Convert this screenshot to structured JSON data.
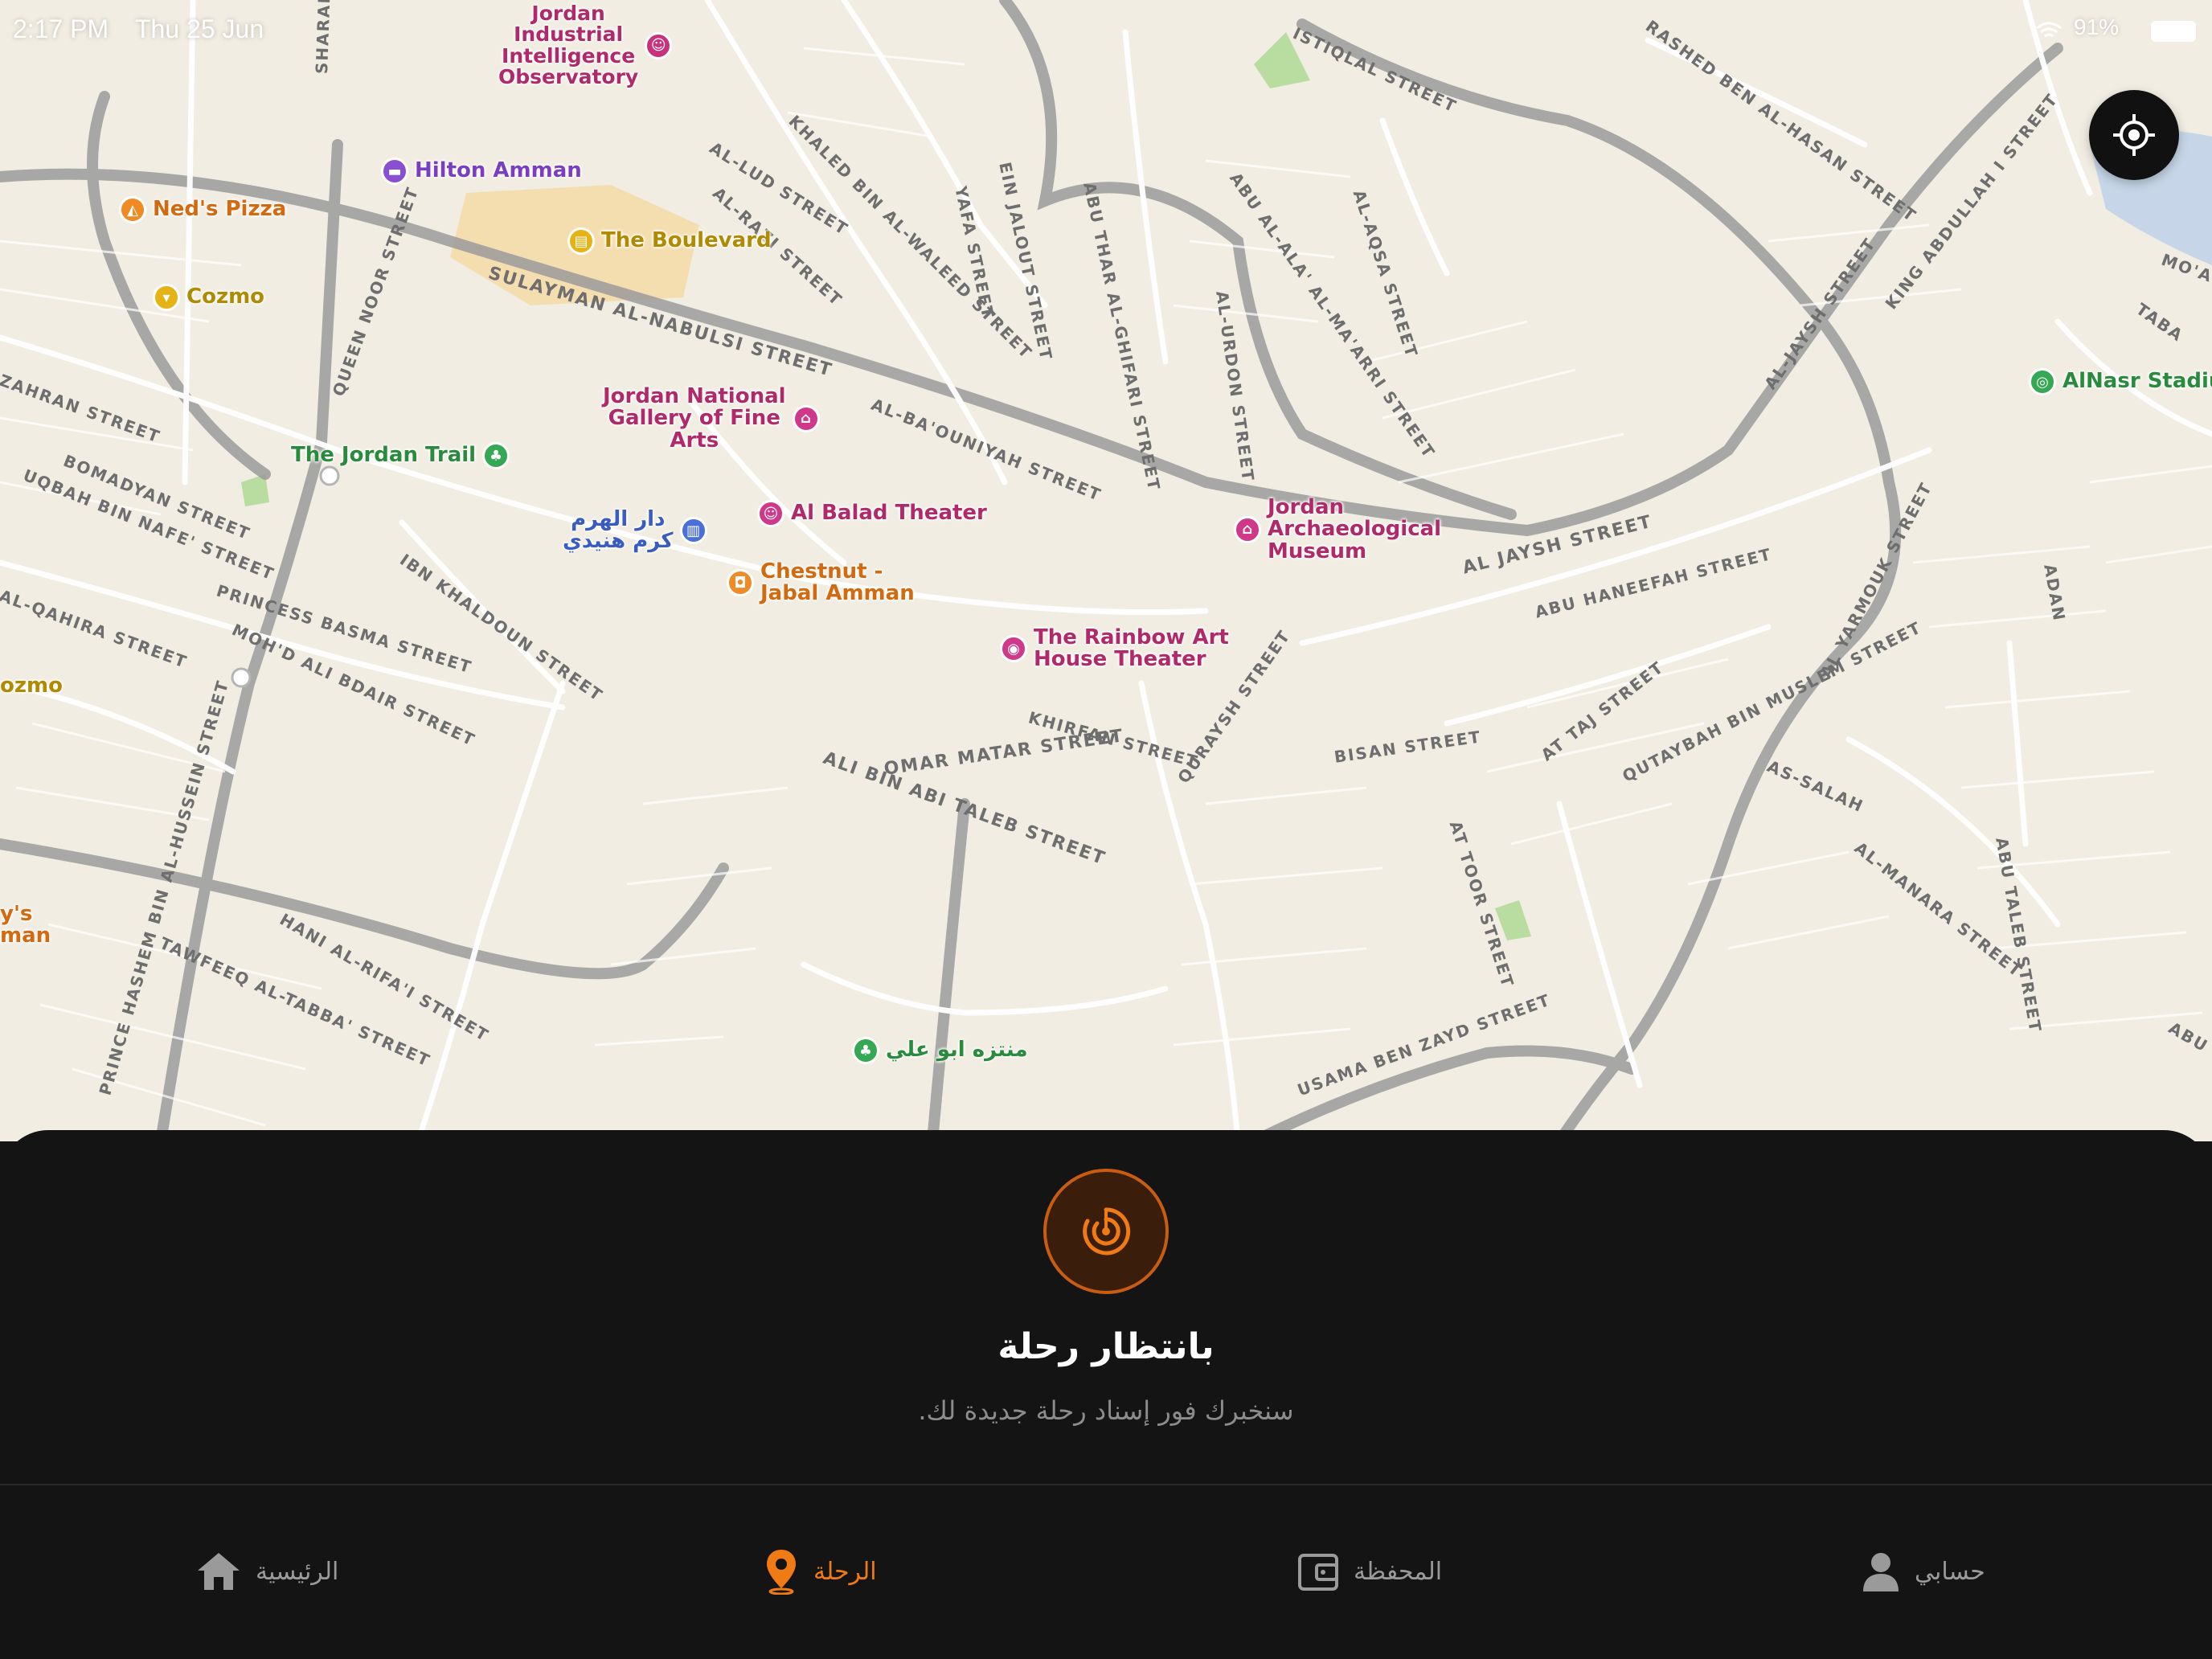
{
  "status_bar": {
    "time": "2:17 PM",
    "date": "Thu 25 Jun",
    "battery": "91%"
  },
  "map": {
    "streets": [
      "ISTIQLAL STREET",
      "RASHED BEN AL-HASAN STREET",
      "KHALED BIN AL-WALEED STREET",
      "AL-LUD STREET",
      "AL-RAZI STREET",
      "SULAYMAN AL-NABULSI STREET",
      "AL-BA'OUNIYAH STREET",
      "QUEEN NOOR STREET",
      "ZAHRAN STREET",
      "BOMADYAN STREET",
      "UQBAH BIN NAFE' STREET",
      "PRINCESS BASMA STREET",
      "IBN KHALDOUN STREET",
      "MOH'D ALI BDAIR STREET",
      "AL-QAHIRA STREET",
      "PRINCE HASHEM BIN AL-HUSSEIN STREET",
      "TAWFEEQ AL-TABBA' STREET",
      "HANI AL-RIFA'I STREET",
      "OMAR MATAR STREET",
      "ALI BIN ABI TALEB STREET",
      "KHIRFAN STREET",
      "QURAYSH STREET",
      "AL JAYSH STREET",
      "AL-JAYSH STREET",
      "KING ABDULLAH I STREET",
      "ABU HANEEFAH STREET",
      "BISAN STREET",
      "AT TAJ STREET",
      "QUTAYBAH BIN MUSLEM STREET",
      "AL YARMOUK STREET",
      "AS-SALAH",
      "AL-MANARA STREET",
      "ABU TALEB STREET",
      "AT TOOR STREET",
      "USAMA BEN ZAYD STREET",
      "AL-URDON STREET",
      "ABU AL-ALA' AL-MA'ARRI STREET",
      "AL-AQSA STREET",
      "ABU THAR AL-GHIFARI STREET",
      "EIN JALOUT STREET",
      "YAFA STREET",
      "SHARAF STREET",
      "ADAN",
      "TABA",
      "MO'AWE",
      "ABU"
    ],
    "pois": [
      {
        "name": "Jordan\nIndustrial\nIntelligence\nObservatory",
        "color": "#c8327a",
        "icon": "theater-icon"
      },
      {
        "name": "Hilton Amman",
        "color": "#8a4fd1",
        "icon": "hotel-icon"
      },
      {
        "name": "Ned's Pizza",
        "color": "#f08a24",
        "icon": "pizza-icon"
      },
      {
        "name": "The Boulevard",
        "color": "#e5b315",
        "icon": "shopping-icon"
      },
      {
        "name": "Cozmo",
        "color": "#e5b315",
        "icon": "cart-icon"
      },
      {
        "name": "Jordan National\nGallery of Fine\nArts",
        "color": "#d0388a",
        "icon": "museum-icon"
      },
      {
        "name": "The Jordan Trail",
        "color": "#34a853",
        "icon": "tree-icon"
      },
      {
        "name": "دار الهرم\nكرم هنيدي",
        "color": "#4a6fd6",
        "icon": "building-icon"
      },
      {
        "name": "Al Balad Theater",
        "color": "#d0388a",
        "icon": "theater-icon"
      },
      {
        "name": "Chestnut -\nJabal Amman",
        "color": "#f08a24",
        "icon": "cafe-icon"
      },
      {
        "name": "Jordan\nArchaeological\nMuseum",
        "color": "#d0388a",
        "icon": "museum-icon"
      },
      {
        "name": "The Rainbow Art\nHouse Theater",
        "color": "#d0388a",
        "icon": "cinema-icon"
      },
      {
        "name": "AlNasr Stadium",
        "color": "#34a853",
        "icon": "stadium-icon"
      },
      {
        "name": "منتزه ابو علي",
        "color": "#34a853",
        "icon": "tree-icon"
      },
      {
        "name": "ozmo",
        "color": "#e5b315",
        "icon": ""
      },
      {
        "name": "y's\nman",
        "color": "#f08a24",
        "icon": ""
      }
    ]
  },
  "locate_button": {
    "icon": "locate-icon"
  },
  "sheet": {
    "icon": "radar-icon",
    "title": "بانتظار رحلة",
    "subtitle": "سنخبرك فور إسناد رحلة جديدة لك."
  },
  "tabs": [
    {
      "id": "home",
      "label": "الرئيسية",
      "icon": "home-icon",
      "active": false
    },
    {
      "id": "trip",
      "label": "الرحلة",
      "icon": "location-pin-icon",
      "active": true
    },
    {
      "id": "wallet",
      "label": "المحفظة",
      "icon": "wallet-icon",
      "active": false
    },
    {
      "id": "account",
      "label": "حسابي",
      "icon": "user-icon",
      "active": false
    }
  ],
  "colors": {
    "accent": "#f07a14",
    "sheet_bg": "#141414",
    "map_bg": "#f1ede2",
    "radar_ring": "#c85c10"
  }
}
